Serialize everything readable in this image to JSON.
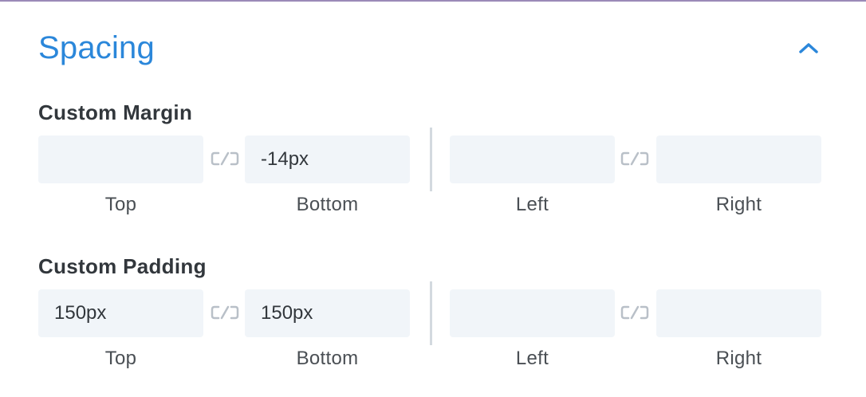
{
  "section": {
    "title": "Spacing",
    "toggle_icon": "chevron-up-icon",
    "accent_color": "#2b87da"
  },
  "margin": {
    "label": "Custom Margin",
    "fields": [
      {
        "side": "Top",
        "value": ""
      },
      {
        "side": "Bottom",
        "value": "-14px"
      },
      {
        "side": "Left",
        "value": ""
      },
      {
        "side": "Right",
        "value": ""
      }
    ],
    "link_icon": "link-toggle-icon"
  },
  "padding": {
    "label": "Custom Padding",
    "fields": [
      {
        "side": "Top",
        "value": "150px"
      },
      {
        "side": "Bottom",
        "value": "150px"
      },
      {
        "side": "Left",
        "value": ""
      },
      {
        "side": "Right",
        "value": ""
      }
    ],
    "link_icon": "link-toggle-icon"
  }
}
